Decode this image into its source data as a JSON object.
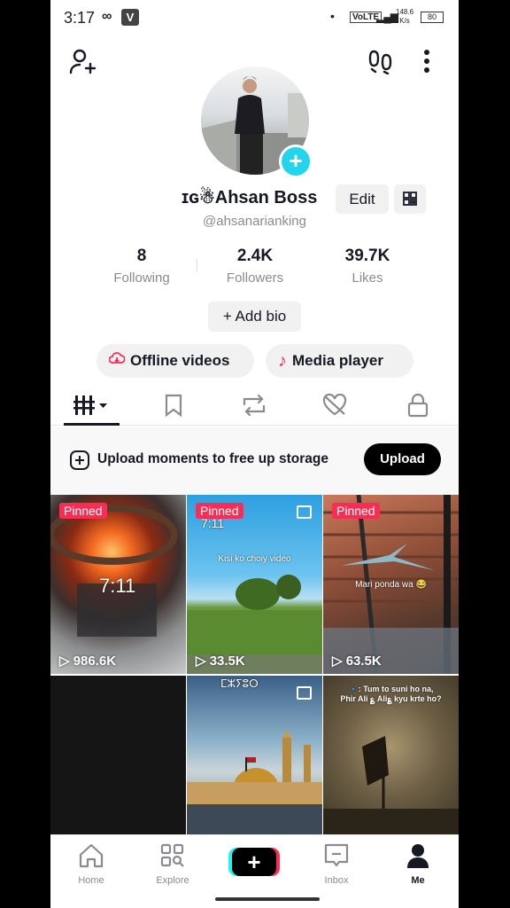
{
  "status_bar": {
    "time": "3:17",
    "infinity": "∞",
    "v_badge": "V",
    "volte": "VoLTE",
    "speed": "148.6\nK/s",
    "battery": "80"
  },
  "profile": {
    "name": "ɪɢ☃Ahsan Boss",
    "handle": "@ahsanarianking",
    "edit_label": "Edit",
    "add_bio_label": "+ Add bio"
  },
  "stats": [
    {
      "value": "8",
      "label": "Following"
    },
    {
      "value": "2.4K",
      "label": "Followers"
    },
    {
      "value": "39.7K",
      "label": "Likes"
    }
  ],
  "pills": {
    "offline": "Offline videos",
    "media": "Media player"
  },
  "upload_bar": {
    "text": "Upload moments to free up storage",
    "button": "Upload"
  },
  "videos": [
    {
      "pinned": "Pinned",
      "views": "986.6K",
      "overlay": "7:11"
    },
    {
      "pinned": "Pinned",
      "views": "33.5K",
      "caption": "Kisi ko choiy video",
      "overlay": "7:11"
    },
    {
      "pinned": "Pinned",
      "views": "63.5K",
      "caption": "Mari ponda wa 😂"
    },
    {},
    {
      "caption": "ⵎⵣⵢⵓⵔ"
    },
    {
      "caption": "🔹: Tum to suni ho na,\nPhir Ali ؏ Ali؏ kyu krte ho?"
    }
  ],
  "nav": {
    "home": "Home",
    "explore": "Explore",
    "inbox": "Inbox",
    "me": "Me"
  },
  "colors": {
    "accent_red": "#fe2c55",
    "accent_cyan": "#20d5ec",
    "text_primary": "#161823",
    "text_secondary": "#8a8b91"
  }
}
